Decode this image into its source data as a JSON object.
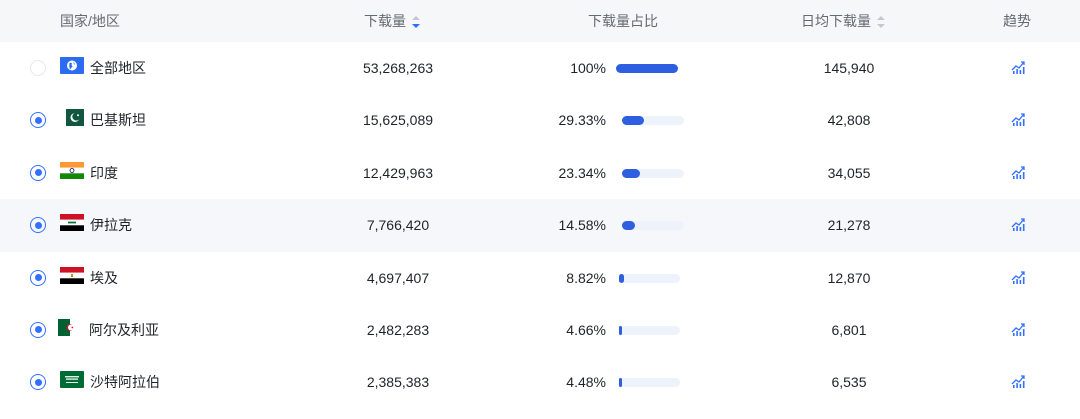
{
  "colors": {
    "accent": "#2d5fe0",
    "bar_track": "#eef2fb",
    "header_bg": "#f6f7f9"
  },
  "header": {
    "country": "国家/地区",
    "downloads": "下载量",
    "share": "下载量占比",
    "daily": "日均下载量",
    "trend": "趋势"
  },
  "rows": [
    {
      "selected": false,
      "flag": "globe-icon",
      "name": "全部地区",
      "downloads": "53,268,263",
      "share_text": "100%",
      "share": 1.0,
      "daily": "145,940"
    },
    {
      "selected": true,
      "flag": "pakistan-flag-icon",
      "name": "巴基斯坦",
      "downloads": "15,625,089",
      "share_text": "29.33%",
      "share": 0.2933,
      "daily": "42,808"
    },
    {
      "selected": true,
      "flag": "india-flag-icon",
      "name": "印度",
      "downloads": "12,429,963",
      "share_text": "23.34%",
      "share": 0.2334,
      "daily": "34,055"
    },
    {
      "selected": true,
      "flag": "iraq-flag-icon",
      "name": "伊拉克",
      "downloads": "7,766,420",
      "share_text": "14.58%",
      "share": 0.1458,
      "daily": "21,278"
    },
    {
      "selected": true,
      "flag": "egypt-flag-icon",
      "name": "埃及",
      "downloads": "4,697,407",
      "share_text": "8.82%",
      "share": 0.0882,
      "daily": "12,870"
    },
    {
      "selected": true,
      "flag": "algeria-flag-icon",
      "name": "阿尔及利亚",
      "downloads": "2,482,283",
      "share_text": "4.66%",
      "share": 0.0466,
      "daily": "6,801"
    },
    {
      "selected": true,
      "flag": "saudi-arabia-flag-icon",
      "name": "沙特阿拉伯",
      "downloads": "2,385,383",
      "share_text": "4.48%",
      "share": 0.0448,
      "daily": "6,535"
    }
  ]
}
